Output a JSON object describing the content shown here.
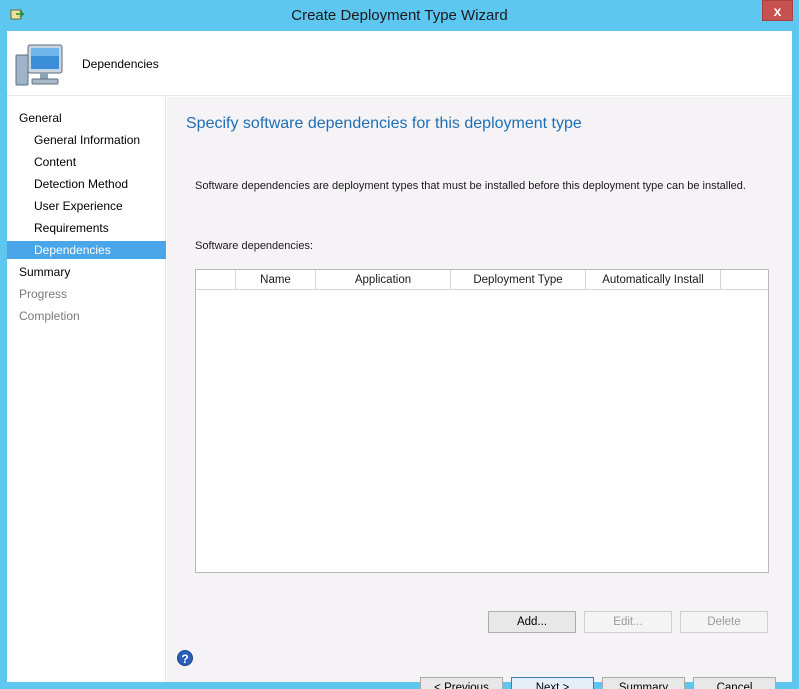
{
  "window": {
    "title": "Create Deployment Type Wizard",
    "close_glyph": "x"
  },
  "header": {
    "title": "Dependencies",
    "icon": "computer-icon"
  },
  "sidebar": {
    "items": [
      {
        "label": "General",
        "state": "normal"
      },
      {
        "label": "General Information",
        "state": "normal"
      },
      {
        "label": "Content",
        "state": "normal"
      },
      {
        "label": "Detection Method",
        "state": "normal"
      },
      {
        "label": "User Experience",
        "state": "normal"
      },
      {
        "label": "Requirements",
        "state": "normal"
      },
      {
        "label": "Dependencies",
        "state": "selected"
      },
      {
        "label": "Summary",
        "state": "normal"
      },
      {
        "label": "Progress",
        "state": "disabled"
      },
      {
        "label": "Completion",
        "state": "disabled"
      }
    ]
  },
  "main": {
    "heading": "Specify software dependencies for this deployment type",
    "description": "Software dependencies are deployment types that must be installed before this deployment type can be installed.",
    "deps_label": "Software dependencies:",
    "columns": [
      "",
      "Name",
      "Application",
      "Deployment Type",
      "Automatically Install",
      ""
    ],
    "rows": [],
    "add_label": "Add...",
    "edit_label": "Edit...",
    "delete_label": "Delete"
  },
  "footer": {
    "previous_label": "< Previous",
    "next_label": "Next >",
    "summary_label": "Summary",
    "cancel_label": "Cancel",
    "help_glyph": "?"
  },
  "colors": {
    "titlebar": "#5ec7f0",
    "selected": "#4aa6e8",
    "heading": "#1f6fb6",
    "close": "#c75050"
  }
}
